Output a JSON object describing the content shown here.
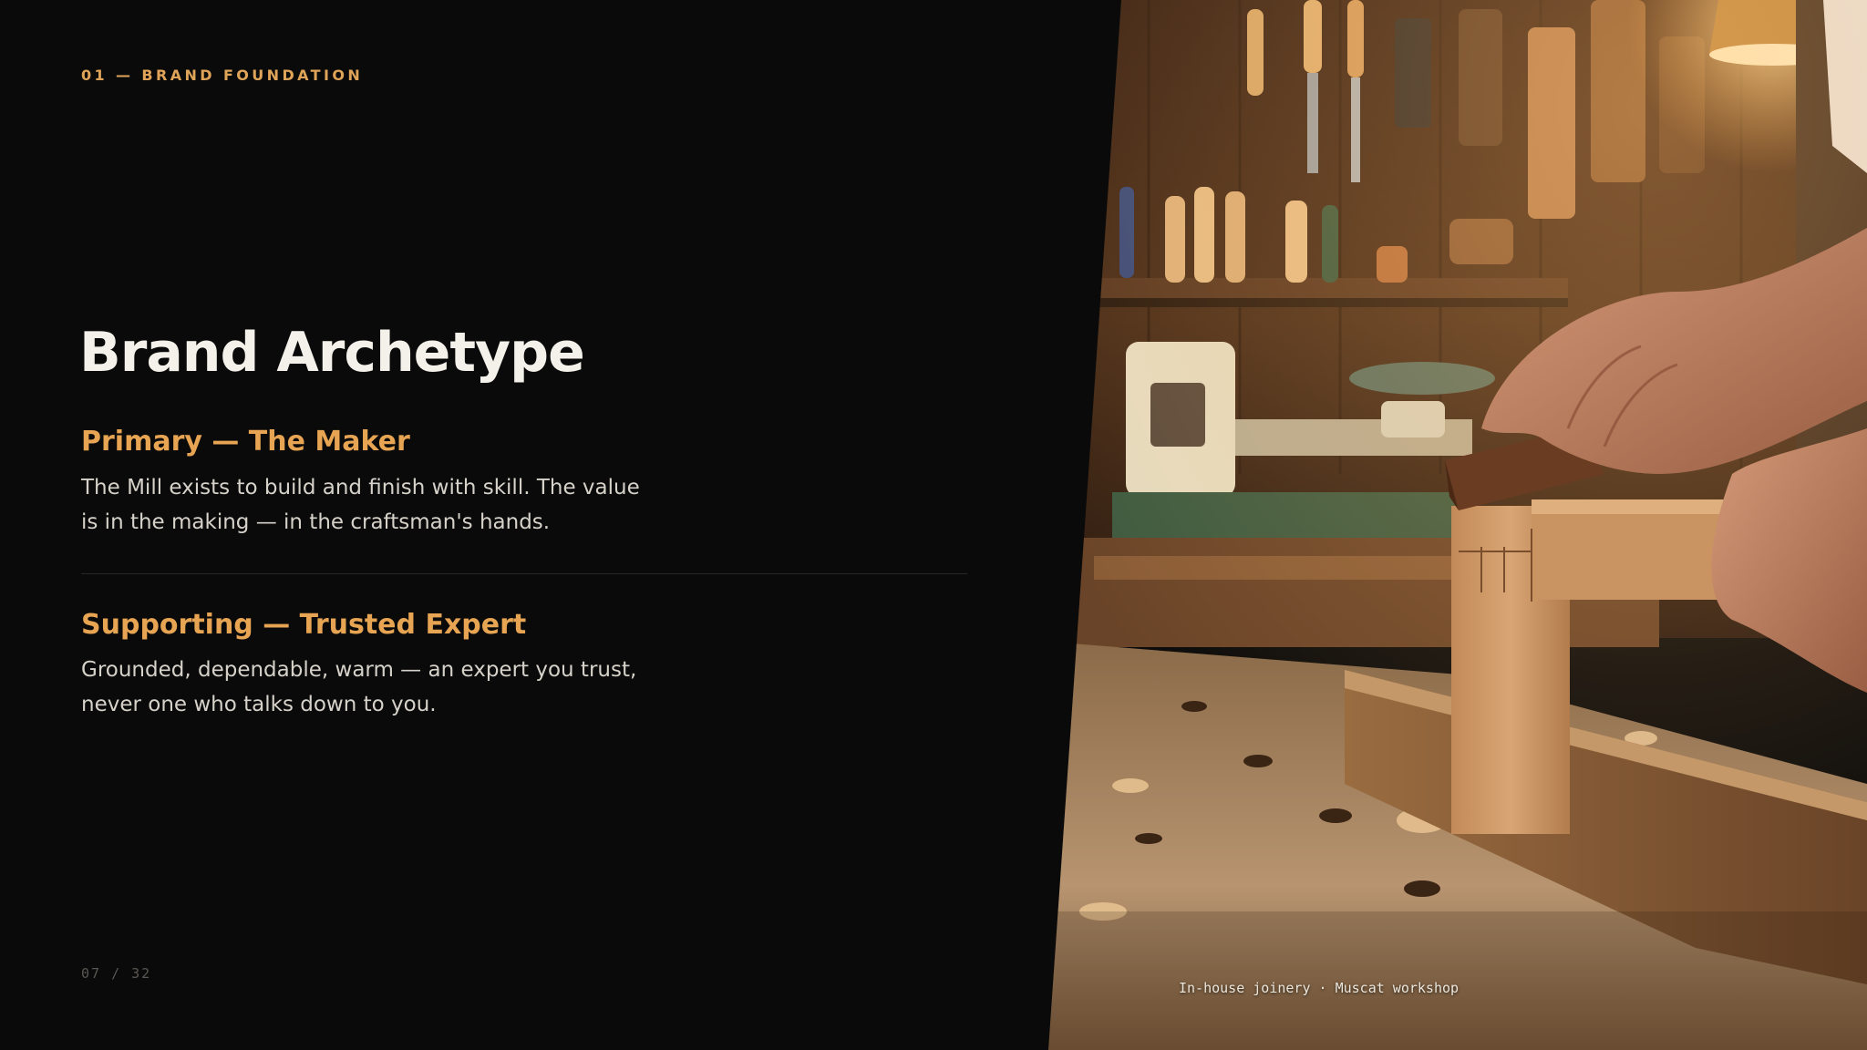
{
  "slide": {
    "eyebrow": "01 — BRAND FOUNDATION",
    "title": "Brand Archetype",
    "sections": [
      {
        "heading": "Primary — The Maker",
        "body": "The Mill exists to build and finish with skill. The value is in the making — in the craftsman's hands."
      },
      {
        "heading": "Supporting — Trusted Expert",
        "body": "Grounded, dependable, warm — an expert you trust, never one who talks down to you."
      }
    ],
    "page_indicator": "07 / 32",
    "photo_caption": "In-house joinery · Muscat workshop"
  },
  "colors": {
    "background": "#0a0a0a",
    "accent": "#e0a458",
    "title": "#f4f1ea",
    "body": "#d6d2ca",
    "muted": "#5a5753"
  },
  "photo": {
    "icon": "workshop-photo-icon"
  }
}
